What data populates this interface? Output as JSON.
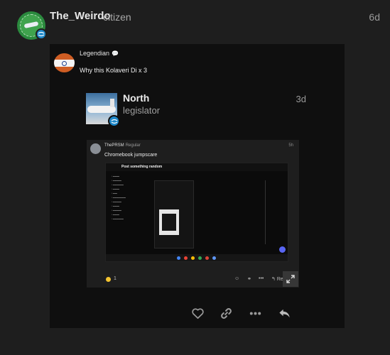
{
  "post": {
    "username": "The_Weirdo",
    "user_title": "citizen",
    "date": "6d"
  },
  "quote": {
    "username": "Legendian",
    "badge_icon": "speech-bubble",
    "text": "Why this Kolaveri Di x 3"
  },
  "north": {
    "name": "North",
    "title": "legislator",
    "date": "3d"
  },
  "deep": {
    "username": "ThePRSM",
    "role": "Regular",
    "date": "5h",
    "text": "Chromebook jumpscare",
    "inner_title": "Post something random",
    "reaction_count": "1",
    "reply_label": "Re"
  },
  "actions": [
    "like-icon",
    "link-icon",
    "more-icon",
    "reply-icon"
  ],
  "colors": {
    "background": "#1e1e1e",
    "embed": "#0f0f0f",
    "flair": "#1e88c9",
    "action_icon": "#9a9a9a"
  }
}
